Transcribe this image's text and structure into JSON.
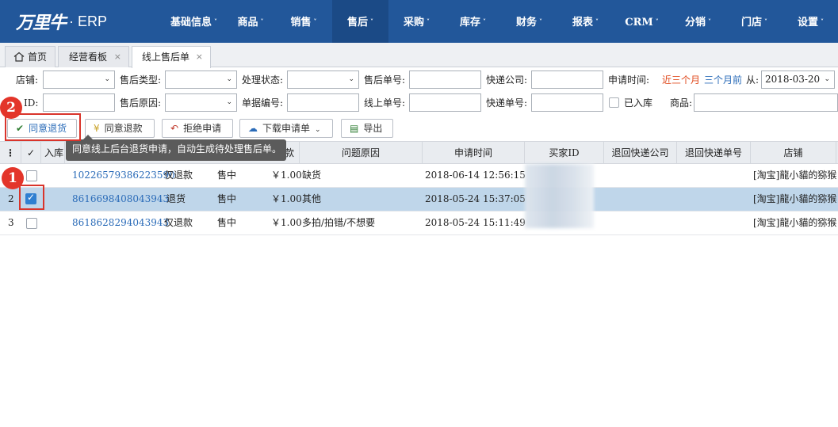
{
  "app": {
    "logo_mark": "万里牛",
    "logo_text": "· ERP"
  },
  "nav": [
    {
      "label": "基础信息"
    },
    {
      "label": "商品"
    },
    {
      "label": "销售"
    },
    {
      "label": "售后"
    },
    {
      "label": "采购"
    },
    {
      "label": "库存"
    },
    {
      "label": "财务"
    },
    {
      "label": "报表"
    },
    {
      "label": "CRM"
    },
    {
      "label": "分销"
    },
    {
      "label": "门店"
    },
    {
      "label": "设置"
    }
  ],
  "nav_active": "售后",
  "tabs": [
    {
      "label": "首页"
    },
    {
      "label": "经营看板"
    },
    {
      "label": "线上售后单"
    }
  ],
  "filters": {
    "shop": "店铺:",
    "aftersale_type": "售后类型:",
    "process_status": "处理状态:",
    "aftersale_no": "售后单号:",
    "express_company": "快递公司:",
    "apply_time": "申请时间:",
    "last_three_months": "近三个月",
    "three_months_ago": "三个月前",
    "from": "从:",
    "date_from": "2018-03-20",
    "id_label": "ID:",
    "aftersale_reason": "售后原因:",
    "doc_no": "单据编号:",
    "online_no": "线上单号:",
    "express_no": "快递单号:",
    "in_stock": "已入库",
    "product": "商品:"
  },
  "toolbar": {
    "agree_return": "同意退货",
    "agree_refund": "同意退款",
    "reject": "拒绝申请",
    "download": "下载申请单",
    "export": "导出"
  },
  "tooltip": "同意线上后台退货申请，自动生成待处理售后单。",
  "table": {
    "headers": [
      "入库",
      "款",
      "问题原因",
      "申请时间",
      "买家ID",
      "退回快递公司",
      "退回快递单号",
      "店铺"
    ],
    "rows": [
      {
        "num": "1",
        "checked": false,
        "order": "10226579386223590",
        "type": "仅退款",
        "status": "售中",
        "amount": "￥1.00",
        "reason": "缺货",
        "time": "2018-06-14 12:56:15",
        "shop": "[淘宝]龍小貓的猕猴"
      },
      {
        "num": "2",
        "checked": true,
        "order": "8616698408043943",
        "type": "退货",
        "status": "售中",
        "amount": "￥1.00",
        "reason": "其他",
        "time": "2018-05-24 15:37:05",
        "shop": "[淘宝]龍小貓的猕猴"
      },
      {
        "num": "3",
        "checked": false,
        "order": "8618628294043943",
        "type": "仅退款",
        "status": "售中",
        "amount": "￥1.00",
        "reason": "多拍/拍错/不想要",
        "time": "2018-05-24 15:11:49",
        "shop": "[淘宝]龍小貓的猕猴"
      }
    ]
  },
  "markers": [
    "1",
    "2"
  ],
  "colors": {
    "nav_bg": "#22579a",
    "selected_row": "#bfd6ea",
    "marker_red": "#e3352a",
    "link_blue": "#2a6bb8"
  }
}
